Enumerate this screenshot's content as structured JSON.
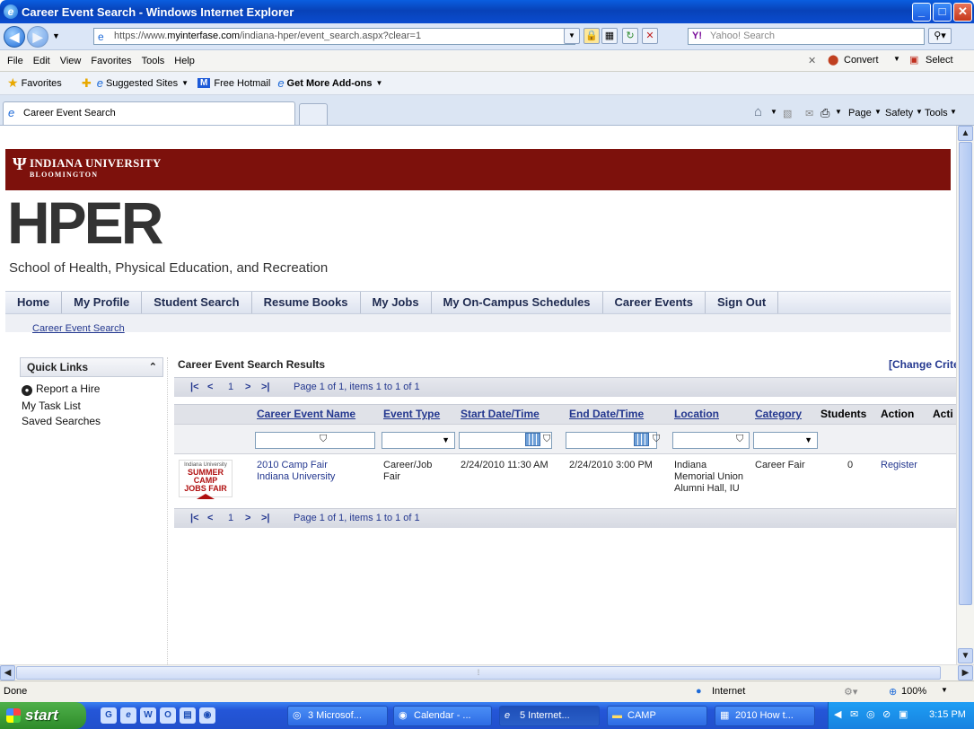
{
  "window": {
    "title": "Career Event Search - Windows Internet Explorer"
  },
  "address": {
    "url_prefix": "https://www.",
    "url_domain": "myinterfase.com",
    "url_path": "/indiana-hper/event_search.aspx?clear=1",
    "search_placeholder": "Yahoo! Search"
  },
  "menu": {
    "items": [
      "File",
      "Edit",
      "View",
      "Favorites",
      "Tools",
      "Help"
    ],
    "convert": "Convert",
    "select": "Select"
  },
  "favorites": {
    "favorites": "Favorites",
    "suggested": "Suggested Sites",
    "hotmail": "Free Hotmail",
    "addons": "Get More Add-ons"
  },
  "tabs": {
    "active": "Career Event Search"
  },
  "cmdbar": {
    "page": "Page",
    "safety": "Safety",
    "tools": "Tools"
  },
  "site": {
    "university": "INDIANA UNIVERSITY",
    "campus": "BLOOMINGTON",
    "school_short": "HPER",
    "school_full": "School of Health, Physical Education, and Recreation"
  },
  "nav": {
    "items": [
      "Home",
      "My Profile",
      "Student Search",
      "Resume Books",
      "My Jobs",
      "My On-Campus Schedules",
      "Career Events",
      "Sign Out"
    ]
  },
  "breadcrumb": "Career Event Search",
  "quick_links": {
    "title": "Quick Links",
    "items": [
      "Report a Hire",
      "My Task List",
      "Saved Searches"
    ]
  },
  "results": {
    "title": "Career Event Search Results",
    "change_criteria": "[Change Crite",
    "pager": {
      "first": "|<",
      "prev": "<",
      "page_num": "1",
      "next": ">",
      "last": ">|",
      "summary": "Page 1 of 1, items 1 to 1 of 1"
    },
    "columns": [
      "Career Event Name",
      "Event Type",
      "Start Date/Time",
      "End Date/Time",
      "Location",
      "Category",
      "Students",
      "Action",
      "Acti"
    ],
    "rows": [
      {
        "thumb_line1": "Indiana University",
        "thumb_line2": "SUMMER CAMP",
        "thumb_line3": "JOBS FAIR",
        "name": "2010 Camp Fair",
        "org": "Indiana University",
        "type": "Career/Job Fair",
        "start": "2/24/2010 11:30 AM",
        "end": "2/24/2010 3:00 PM",
        "location": "Indiana Memorial Union Alumni Hall, IU",
        "category": "Career Fair",
        "students": "0",
        "action": "Register"
      }
    ]
  },
  "status": {
    "text": "Done",
    "zone": "Internet",
    "zoom": "100%"
  },
  "taskbar": {
    "start": "start",
    "items": [
      "3 Microsof...",
      "Calendar - ...",
      "5 Internet...",
      "CAMP",
      "2010 How t..."
    ],
    "clock": "3:15 PM"
  }
}
